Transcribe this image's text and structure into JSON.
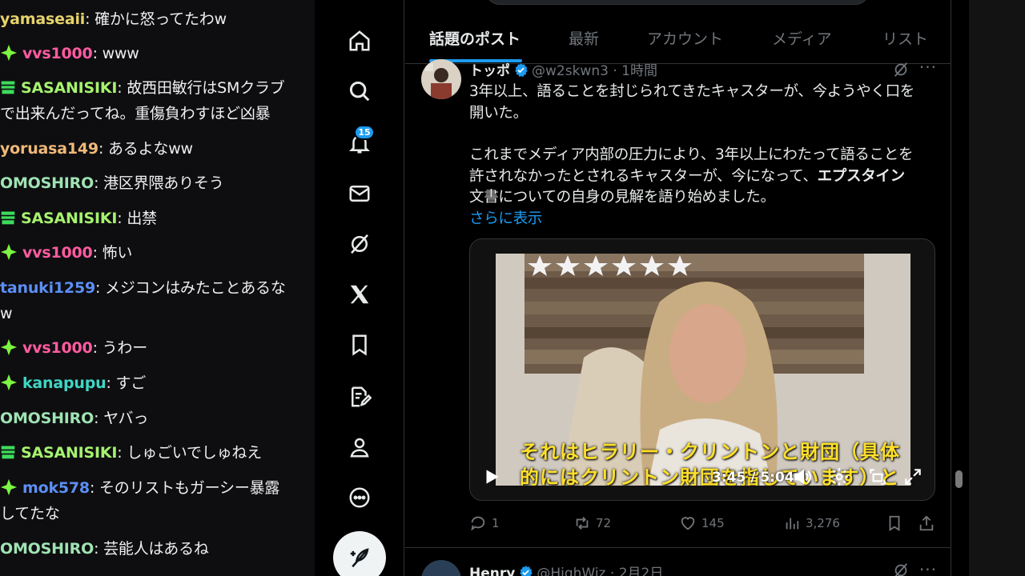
{
  "chat": {
    "messages": [
      {
        "badge": "none",
        "user": "yamaseaii",
        "color": "#e7d36a",
        "text": "確かに怒ってたわw",
        "cont": ""
      },
      {
        "badge": "diamond",
        "user": "vvs1000",
        "color": "#ff5ba0",
        "text": "www",
        "cont": ""
      },
      {
        "badge": "gift",
        "user": "SASANISIKI",
        "color": "#a6f26f",
        "text": "故西田敏行はSMクラブ",
        "cont": "で出来んだってね。重傷負わすほど凶暴"
      },
      {
        "badge": "none",
        "user": "yoruasa149",
        "color": "#f0b978",
        "text": "あるよなww",
        "cont": ""
      },
      {
        "badge": "none",
        "user": "OMOSHIRO",
        "color": "#9fe3b4",
        "text": "港区界隈ありそう",
        "cont": ""
      },
      {
        "badge": "gift",
        "user": "SASANISIKI",
        "color": "#a6f26f",
        "text": "出禁",
        "cont": ""
      },
      {
        "badge": "diamond",
        "user": "vvs1000",
        "color": "#ff5ba0",
        "text": "怖い",
        "cont": ""
      },
      {
        "badge": "none",
        "user": "tanuki1259",
        "color": "#5c8ff5",
        "text": "メジコンはみたことあるな",
        "cont": "w"
      },
      {
        "badge": "diamond",
        "user": "vvs1000",
        "color": "#ff5ba0",
        "text": "うわー",
        "cont": ""
      },
      {
        "badge": "diamond",
        "user": "kanapupu",
        "color": "#3ed6c4",
        "text": "すご",
        "cont": ""
      },
      {
        "badge": "none",
        "user": "OMOSHIRO",
        "color": "#9fe3b4",
        "text": "ヤバっ",
        "cont": ""
      },
      {
        "badge": "gift",
        "user": "SASANISIKI",
        "color": "#a6f26f",
        "text": "しゅごいでしゅねえ",
        "cont": ""
      },
      {
        "badge": "diamond",
        "user": "mok578",
        "color": "#5c8ff5",
        "text": "そのリストもガーシー暴露",
        "cont": "してたな"
      },
      {
        "badge": "none",
        "user": "OMOSHIRO",
        "color": "#9fe3b4",
        "text": "芸能人はあるね",
        "cont": ""
      }
    ]
  },
  "nav": {
    "icons": [
      "home-icon",
      "search-icon",
      "notifications-icon",
      "messages-icon",
      "grok-icon",
      "x-premium-icon",
      "bookmarks-icon",
      "lists-icon",
      "profile-icon",
      "more-icon"
    ],
    "notification_count": "15"
  },
  "tabs": [
    "話題のポスト",
    "最新",
    "アカウント",
    "メディア",
    "リスト"
  ],
  "tweets": [
    {
      "name": "トッポ",
      "handle": "@w2skwn3",
      "time": "1時間",
      "body_1": "3年以上、語ることを封じられてきたキャスターが、今ようやく口を",
      "body_2": "開いた。",
      "body_3": "これまでメディア内部の圧力により、3年以上にわたって語ることを",
      "body_4a": "許されなかったとされるキャスターが、今になって、",
      "body_4b": "エプスタイン",
      "body_5": "文書についての自身の見解を語り始めました。",
      "show_more": "さらに表示",
      "video": {
        "caption_1": "それはヒラリー・クリントンと財団（具体",
        "caption_2": "的にはクリントン財団を指しています）と",
        "time": "3:45 / 5:04"
      },
      "stats": {
        "replies": "1",
        "reposts": "72",
        "likes": "145",
        "views": "3,276"
      }
    },
    {
      "name": "Henry",
      "handle": "@HighWiz",
      "time": "2月2日"
    }
  ]
}
